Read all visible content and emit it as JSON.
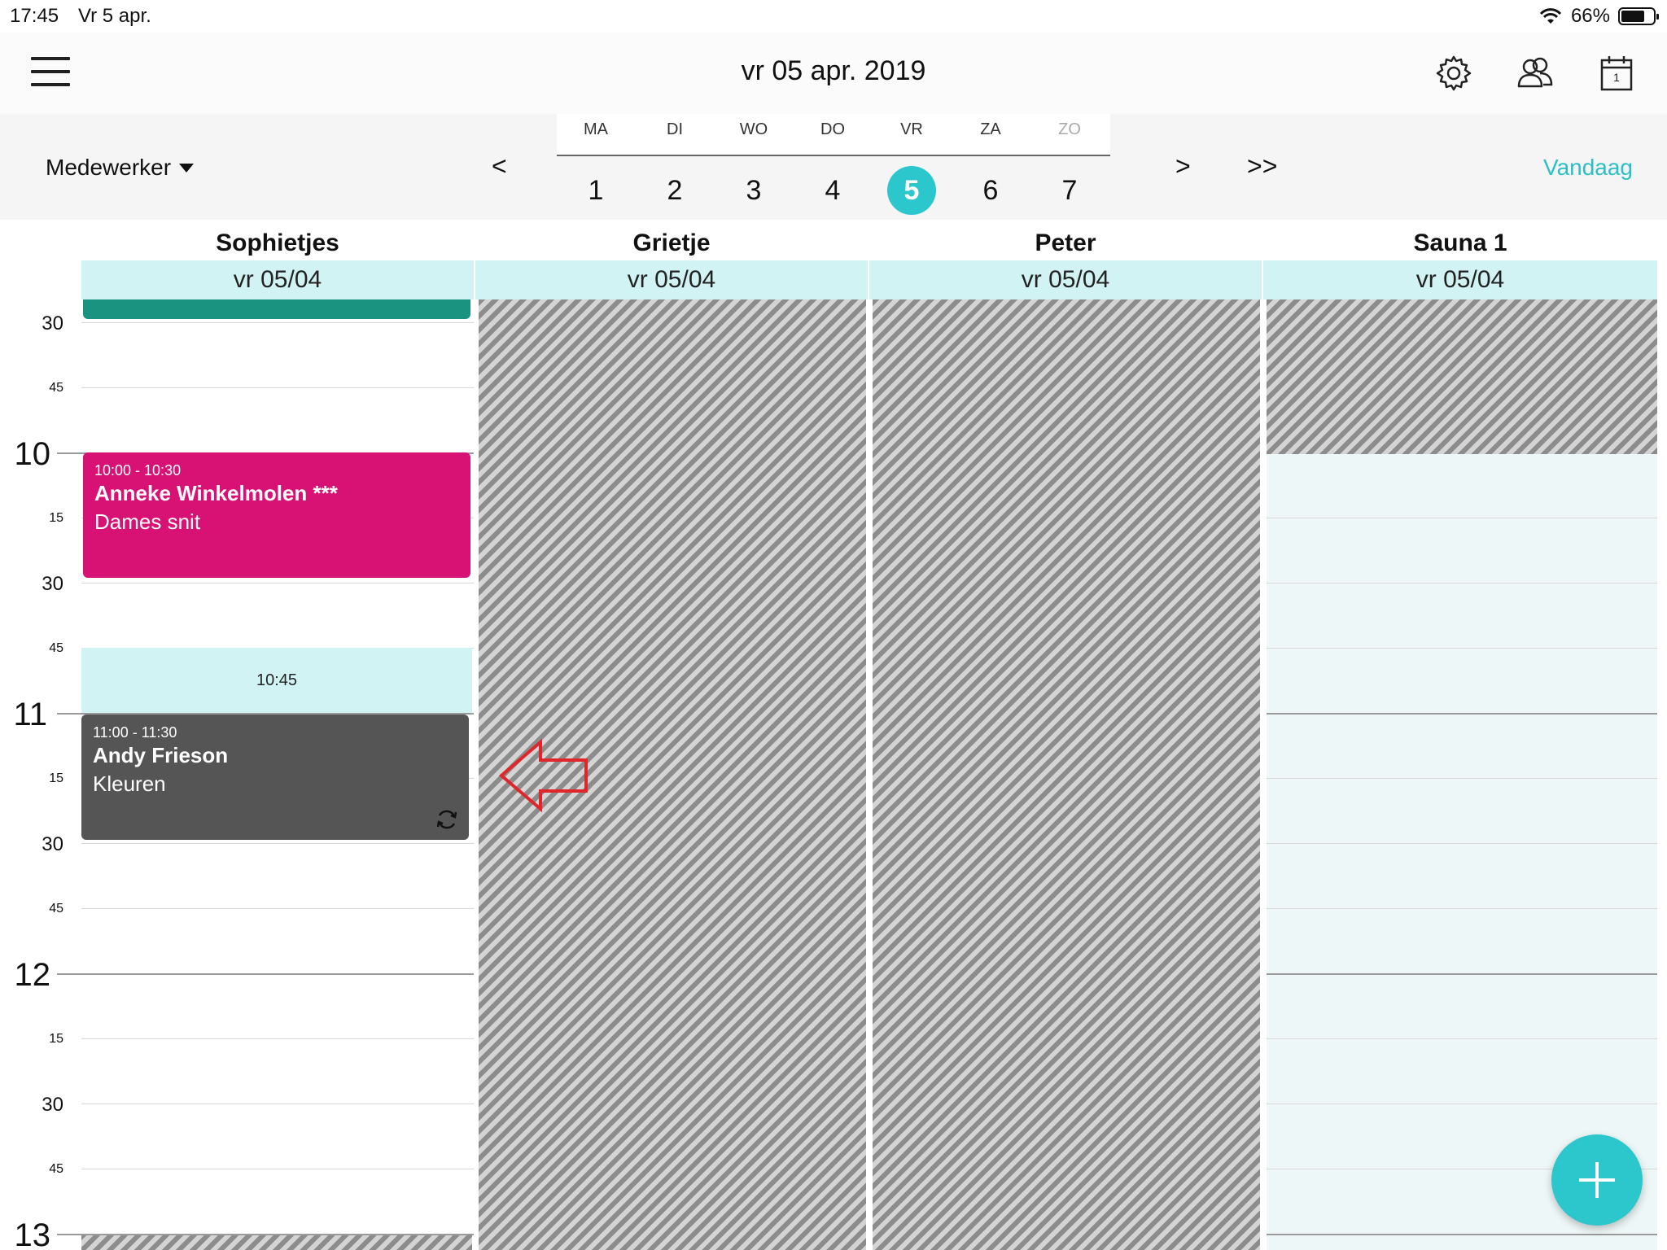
{
  "status_bar": {
    "time": "17:45",
    "date": "Vr 5 apr.",
    "battery": "66%"
  },
  "navbar": {
    "title": "vr 05 apr. 2019",
    "icons": [
      "menu-icon",
      "gear-icon",
      "people-icon",
      "calendar-icon"
    ],
    "calendar_icon_day": "1"
  },
  "week": {
    "filter_label": "Medewerker",
    "prev_label": "<",
    "next_label": ">",
    "next_week_label": ">>",
    "today_label": "Vandaag",
    "days": [
      {
        "abbr": "MA",
        "num": "1"
      },
      {
        "abbr": "DI",
        "num": "2"
      },
      {
        "abbr": "WO",
        "num": "3"
      },
      {
        "abbr": "DO",
        "num": "4"
      },
      {
        "abbr": "VR",
        "num": "5"
      },
      {
        "abbr": "ZA",
        "num": "6"
      },
      {
        "abbr": "ZO",
        "num": "7"
      }
    ],
    "selected_day": "5"
  },
  "resources": [
    {
      "name": "Sophietjes",
      "date": "vr 05/04"
    },
    {
      "name": "Grietje",
      "date": "vr 05/04"
    },
    {
      "name": "Peter",
      "date": "vr 05/04"
    },
    {
      "name": "Sauna  1",
      "date": "vr 05/04"
    }
  ],
  "time_labels": {
    "h10": "10",
    "h11": "11",
    "h12": "12",
    "h13": "13",
    "m15": "15",
    "m30": "30",
    "m45": "45"
  },
  "appointments": [
    {
      "time": "10:00 - 10:30",
      "name": "Anneke Winkelmolen ***",
      "service": "Dames snit",
      "color": "#d81174"
    },
    {
      "time": "11:00 - 11:30",
      "name": "Andy Frieson",
      "service": "Kleuren",
      "color": "#555555"
    }
  ],
  "slot_label": "10:45",
  "colors": {
    "accent": "#2cc7cc",
    "teal_block": "#1a9380",
    "annotation_arrow": "#e0262b"
  }
}
